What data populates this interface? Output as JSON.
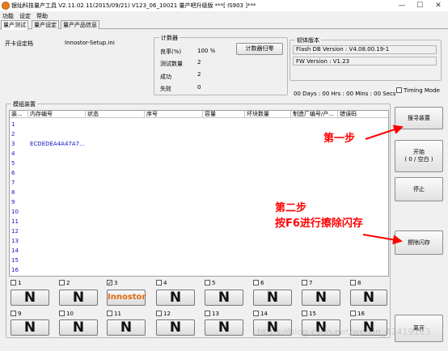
{
  "window": {
    "title": "银灿科技量产工具 V2.11.02.11(2015/09/21)   V123_06_10021 量产吧升级版              ***[ IS903 ]***",
    "minimize": "—",
    "maximize": "☐",
    "close": "✕"
  },
  "menu": [
    "功能",
    "设定",
    "帮助"
  ],
  "tabs": [
    "量产测试",
    "量产设定",
    "量产产品信息"
  ],
  "settings": {
    "label": "开卡设定档",
    "file": "Innostor-Setup.ini"
  },
  "counter": {
    "group_label": "计数器",
    "rows": [
      {
        "label": "良率(%)",
        "value": "100 %"
      },
      {
        "label": "测试数量",
        "value": "2"
      },
      {
        "label": "成功",
        "value": "2"
      },
      {
        "label": "失败",
        "value": "0"
      }
    ],
    "reset_button": "计数器归零"
  },
  "firmware": {
    "group_label": "韧体版本",
    "flash_db": "Flash DB Version :  V4.08.00.19-1",
    "fw": "FW Version :   V1.23"
  },
  "timer": "00 Days : 00 Hrs : 00 Mins : 00 Secs",
  "timing_mode": "Timing Mode",
  "devices": {
    "group_label": "模组装置",
    "columns": [
      "装...",
      "内存编号",
      "状态",
      "序号",
      "容量",
      "坏块数量",
      "制造厂编号/产...",
      "错误码"
    ],
    "rows": [
      "1",
      "2",
      "3",
      "4",
      "5",
      "6",
      "7",
      "8",
      "9",
      "10",
      "11",
      "12",
      "13",
      "14",
      "15",
      "16"
    ],
    "row3_memory_id": "ECDEDEA4A47A7..."
  },
  "buttons": {
    "search": "搜寻装置",
    "start_line1": "开始",
    "start_line2": "( 0 / 空白 )",
    "stop": "停止",
    "erase": "擦除闪存",
    "exit": "离开"
  },
  "slots": [
    {
      "num": "1",
      "checked": false,
      "label": "N"
    },
    {
      "num": "2",
      "checked": false,
      "label": "N"
    },
    {
      "num": "3",
      "checked": true,
      "label": "Innostor"
    },
    {
      "num": "4",
      "checked": false,
      "label": "N"
    },
    {
      "num": "5",
      "checked": false,
      "label": "N"
    },
    {
      "num": "6",
      "checked": false,
      "label": "N"
    },
    {
      "num": "7",
      "checked": false,
      "label": "N"
    },
    {
      "num": "8",
      "checked": false,
      "label": "N"
    },
    {
      "num": "9",
      "checked": false,
      "label": "N"
    },
    {
      "num": "10",
      "checked": false,
      "label": "N"
    },
    {
      "num": "11",
      "checked": false,
      "label": "N"
    },
    {
      "num": "12",
      "checked": false,
      "label": "N"
    },
    {
      "num": "13",
      "checked": false,
      "label": "N"
    },
    {
      "num": "14",
      "checked": false,
      "label": "N"
    },
    {
      "num": "15",
      "checked": false,
      "label": "N"
    },
    {
      "num": "16",
      "checked": false,
      "label": "N"
    }
  ],
  "annotations": {
    "step1": "第一步",
    "step2_line1": "第二步",
    "step2_line2": "按F6进行擦除闪存"
  },
  "watermark": "https://blog.csdn.net/weixin_42419183",
  "colors": {
    "accent_blue": "#1616c8",
    "annotation_red": "#ff0000",
    "innostor_orange": "#e06a12"
  }
}
